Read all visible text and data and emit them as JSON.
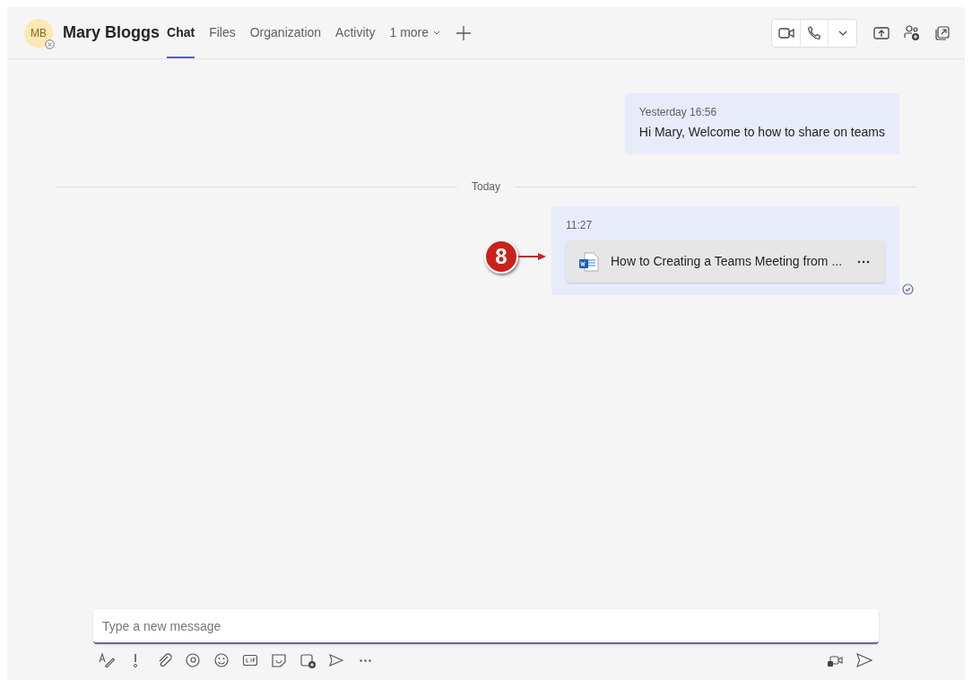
{
  "header": {
    "avatar_initials": "MB",
    "name": "Mary Bloggs",
    "tabs": [
      {
        "label": "Chat",
        "selected": true
      },
      {
        "label": "Files",
        "selected": false
      },
      {
        "label": "Organization",
        "selected": false
      },
      {
        "label": "Activity",
        "selected": false
      },
      {
        "label": "1 more",
        "selected": false,
        "kind": "more"
      }
    ]
  },
  "messages": [
    {
      "kind": "text",
      "time": "Yesterday 16:56",
      "text": "Hi Mary, Welcome to how to share on teams"
    },
    {
      "kind": "divider",
      "text": "Today"
    },
    {
      "kind": "file",
      "time": "11:27",
      "file_name": "How to Creating a Teams Meeting from ...",
      "callout": "8",
      "read": true
    }
  ],
  "composer": {
    "placeholder": "Type a new message"
  }
}
